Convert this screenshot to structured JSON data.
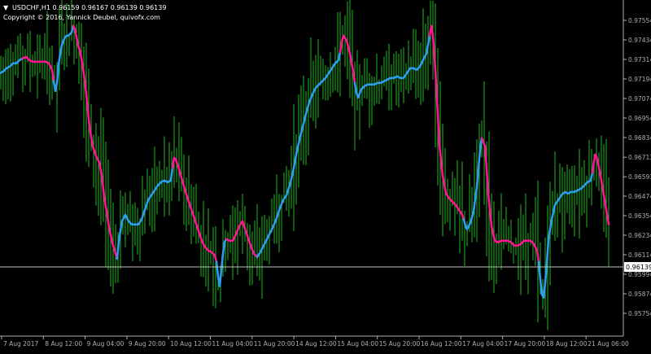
{
  "header": {
    "arrow": "▼",
    "symbol_line": "USDCHF,H1  0.96159 0.96167 0.96139 0.96139",
    "copyright": "Copyright © 2016, Yannick Deubel, quivofx.com"
  },
  "colors": {
    "background": "#000000",
    "bars": "#1fb81f",
    "ma_up": "#2e9cf0",
    "ma_down": "#ff1493",
    "axis": "#b0b0b0",
    "price_line": "#c0c0c0",
    "current_price_box": "#ffffff"
  },
  "current_price": "0.96139",
  "chart_data": {
    "type": "line",
    "title": "USDCHF,H1",
    "y_axis_ticks": [
      0.97554,
      0.97434,
      0.97314,
      0.97194,
      0.97074,
      0.96954,
      0.96834,
      0.96713,
      0.96593,
      0.96474,
      0.96354,
      0.96234,
      0.96114,
      0.95994,
      0.95874,
      0.95754
    ],
    "x_axis_ticks": [
      "7 Aug 2017",
      "8 Aug 12:00",
      "9 Aug 04:00",
      "9 Aug 20:00",
      "10 Aug 12:00",
      "11 Aug 04:00",
      "11 Aug 20:00",
      "14 Aug 12:00",
      "15 Aug 04:00",
      "15 Aug 20:00",
      "16 Aug 12:00",
      "17 Aug 04:00",
      "17 Aug 20:00",
      "18 Aug 12:00",
      "21 Aug 06:00"
    ],
    "ylim": [
      0.95734,
      0.97614
    ],
    "series": [
      {
        "style": "two-color moving average",
        "points": [
          [
            0,
            0.9723,
            "up"
          ],
          [
            4,
            0.9724,
            "up"
          ],
          [
            8,
            0.9726,
            "up"
          ],
          [
            12,
            0.9727,
            "up"
          ],
          [
            16,
            0.9729,
            "up"
          ],
          [
            20,
            0.9729,
            "up"
          ],
          [
            24,
            0.9731,
            "up"
          ],
          [
            28,
            0.9732,
            "down"
          ],
          [
            32,
            0.9733,
            "down"
          ],
          [
            36,
            0.9731,
            "down"
          ],
          [
            40,
            0.973,
            "down"
          ],
          [
            44,
            0.973,
            "down"
          ],
          [
            48,
            0.973,
            "down"
          ],
          [
            52,
            0.973,
            "down"
          ],
          [
            56,
            0.973,
            "down"
          ],
          [
            60,
            0.9729,
            "down"
          ],
          [
            64,
            0.9725,
            "down"
          ],
          [
            66,
            0.9718,
            "up"
          ],
          [
            68,
            0.9712,
            "up"
          ],
          [
            70,
            0.9717,
            "up"
          ],
          [
            72,
            0.9728,
            "up"
          ],
          [
            74,
            0.9735,
            "up"
          ],
          [
            76,
            0.974,
            "up"
          ],
          [
            78,
            0.9743,
            "up"
          ],
          [
            80,
            0.9745,
            "up"
          ],
          [
            82,
            0.9746,
            "up"
          ],
          [
            84,
            0.9746,
            "up"
          ],
          [
            86,
            0.9747,
            "up"
          ],
          [
            88,
            0.9748,
            "up"
          ],
          [
            90,
            0.9752,
            "down"
          ],
          [
            92,
            0.975,
            "down"
          ],
          [
            94,
            0.9745,
            "down"
          ],
          [
            96,
            0.974,
            "down"
          ],
          [
            98,
            0.9737,
            "down"
          ],
          [
            100,
            0.9732,
            "down"
          ],
          [
            102,
            0.9726,
            "down"
          ],
          [
            104,
            0.9719,
            "down"
          ],
          [
            106,
            0.971,
            "down"
          ],
          [
            108,
            0.97,
            "down"
          ],
          [
            110,
            0.969,
            "down"
          ],
          [
            114,
            0.9678,
            "down"
          ],
          [
            118,
            0.9672,
            "down"
          ],
          [
            122,
            0.9668,
            "down"
          ],
          [
            125,
            0.966,
            "down"
          ],
          [
            128,
            0.9647,
            "down"
          ],
          [
            132,
            0.9635,
            "down"
          ],
          [
            134,
            0.9628,
            "down"
          ],
          [
            138,
            0.9619,
            "down"
          ],
          [
            142,
            0.9612,
            "down"
          ],
          [
            144,
            0.9609,
            "up"
          ],
          [
            146,
            0.962,
            "up"
          ],
          [
            150,
            0.9632,
            "up"
          ],
          [
            154,
            0.9636,
            "up"
          ],
          [
            158,
            0.9632,
            "up"
          ],
          [
            162,
            0.963,
            "up"
          ],
          [
            166,
            0.963,
            "up"
          ],
          [
            170,
            0.963,
            "up"
          ],
          [
            174,
            0.9633,
            "up"
          ],
          [
            178,
            0.9639,
            "up"
          ],
          [
            182,
            0.9645,
            "up"
          ],
          [
            186,
            0.9648,
            "up"
          ],
          [
            190,
            0.9651,
            "up"
          ],
          [
            194,
            0.9654,
            "up"
          ],
          [
            198,
            0.9656,
            "up"
          ],
          [
            202,
            0.9657,
            "up"
          ],
          [
            206,
            0.9656,
            "up"
          ],
          [
            210,
            0.9657,
            "up"
          ],
          [
            212,
            0.9665,
            "down"
          ],
          [
            214,
            0.9671,
            "down"
          ],
          [
            216,
            0.967,
            "down"
          ],
          [
            220,
            0.9664,
            "down"
          ],
          [
            224,
            0.9657,
            "down"
          ],
          [
            228,
            0.965,
            "down"
          ],
          [
            232,
            0.9644,
            "down"
          ],
          [
            236,
            0.9638,
            "down"
          ],
          [
            240,
            0.9632,
            "down"
          ],
          [
            244,
            0.9626,
            "down"
          ],
          [
            248,
            0.962,
            "down"
          ],
          [
            252,
            0.9616,
            "down"
          ],
          [
            256,
            0.9614,
            "down"
          ],
          [
            260,
            0.9613,
            "down"
          ],
          [
            264,
            0.9611,
            "down"
          ],
          [
            266,
            0.9607,
            "up"
          ],
          [
            268,
            0.9598,
            "up"
          ],
          [
            270,
            0.9592,
            "up"
          ],
          [
            272,
            0.9602,
            "up"
          ],
          [
            274,
            0.9612,
            "up"
          ],
          [
            276,
            0.9619,
            "up"
          ],
          [
            278,
            0.9621,
            "down"
          ],
          [
            282,
            0.962,
            "down"
          ],
          [
            286,
            0.962,
            "down"
          ],
          [
            290,
            0.9624,
            "down"
          ],
          [
            294,
            0.9629,
            "down"
          ],
          [
            298,
            0.9632,
            "down"
          ],
          [
            300,
            0.9629,
            "down"
          ],
          [
            304,
            0.9623,
            "down"
          ],
          [
            308,
            0.9617,
            "down"
          ],
          [
            312,
            0.9612,
            "down"
          ],
          [
            316,
            0.961,
            "up"
          ],
          [
            320,
            0.9613,
            "up"
          ],
          [
            324,
            0.9617,
            "up"
          ],
          [
            328,
            0.9621,
            "up"
          ],
          [
            332,
            0.9625,
            "up"
          ],
          [
            336,
            0.9629,
            "up"
          ],
          [
            340,
            0.9634,
            "up"
          ],
          [
            344,
            0.964,
            "up"
          ],
          [
            348,
            0.9645,
            "up"
          ],
          [
            352,
            0.9648,
            "up"
          ],
          [
            356,
            0.9654,
            "up"
          ],
          [
            360,
            0.9662,
            "up"
          ],
          [
            364,
            0.9673,
            "up"
          ],
          [
            368,
            0.9682,
            "up"
          ],
          [
            372,
            0.969,
            "up"
          ],
          [
            376,
            0.9698,
            "up"
          ],
          [
            380,
            0.9705,
            "up"
          ],
          [
            384,
            0.971,
            "up"
          ],
          [
            388,
            0.9714,
            "up"
          ],
          [
            392,
            0.9716,
            "up"
          ],
          [
            396,
            0.9718,
            "up"
          ],
          [
            400,
            0.972,
            "up"
          ],
          [
            404,
            0.9723,
            "up"
          ],
          [
            408,
            0.9726,
            "up"
          ],
          [
            412,
            0.9729,
            "up"
          ],
          [
            416,
            0.9731,
            "up"
          ],
          [
            418,
            0.9736,
            "down"
          ],
          [
            420,
            0.9742,
            "down"
          ],
          [
            422,
            0.9746,
            "down"
          ],
          [
            426,
            0.9743,
            "down"
          ],
          [
            430,
            0.9735,
            "down"
          ],
          [
            434,
            0.9724,
            "down"
          ],
          [
            436,
            0.9717,
            "up"
          ],
          [
            438,
            0.9711,
            "up"
          ],
          [
            440,
            0.9708,
            "up"
          ],
          [
            444,
            0.9713,
            "up"
          ],
          [
            448,
            0.9715,
            "up"
          ],
          [
            452,
            0.9716,
            "up"
          ],
          [
            456,
            0.9716,
            "up"
          ],
          [
            460,
            0.9716,
            "up"
          ],
          [
            464,
            0.9717,
            "up"
          ],
          [
            468,
            0.9717,
            "up"
          ],
          [
            472,
            0.9718,
            "up"
          ],
          [
            476,
            0.9719,
            "up"
          ],
          [
            480,
            0.972,
            "up"
          ],
          [
            484,
            0.972,
            "up"
          ],
          [
            488,
            0.9721,
            "up"
          ],
          [
            492,
            0.972,
            "up"
          ],
          [
            496,
            0.972,
            "up"
          ],
          [
            500,
            0.9723,
            "up"
          ],
          [
            504,
            0.9726,
            "up"
          ],
          [
            508,
            0.9726,
            "up"
          ],
          [
            512,
            0.9725,
            "up"
          ],
          [
            516,
            0.9727,
            "up"
          ],
          [
            520,
            0.9731,
            "up"
          ],
          [
            524,
            0.9735,
            "up"
          ],
          [
            528,
            0.9746,
            "down"
          ],
          [
            530,
            0.9752,
            "down"
          ],
          [
            532,
            0.9746,
            "down"
          ],
          [
            534,
            0.9733,
            "down"
          ],
          [
            536,
            0.9716,
            "down"
          ],
          [
            538,
            0.9698,
            "down"
          ],
          [
            540,
            0.9679,
            "down"
          ],
          [
            544,
            0.966,
            "down"
          ],
          [
            548,
            0.9649,
            "down"
          ],
          [
            552,
            0.9646,
            "down"
          ],
          [
            556,
            0.9644,
            "down"
          ],
          [
            560,
            0.9642,
            "down"
          ],
          [
            564,
            0.9639,
            "down"
          ],
          [
            568,
            0.9636,
            "down"
          ],
          [
            570,
            0.9633,
            "up"
          ],
          [
            572,
            0.9629,
            "up"
          ],
          [
            574,
            0.9627,
            "up"
          ],
          [
            578,
            0.9631,
            "up"
          ],
          [
            582,
            0.9638,
            "up"
          ],
          [
            586,
            0.9653,
            "up"
          ],
          [
            590,
            0.9676,
            "up"
          ],
          [
            592,
            0.9683,
            "down"
          ],
          [
            596,
            0.9678,
            "down"
          ],
          [
            598,
            0.9664,
            "down"
          ],
          [
            600,
            0.9649,
            "down"
          ],
          [
            604,
            0.9629,
            "down"
          ],
          [
            608,
            0.962,
            "down"
          ],
          [
            612,
            0.9619,
            "down"
          ],
          [
            616,
            0.962,
            "down"
          ],
          [
            620,
            0.962,
            "down"
          ],
          [
            624,
            0.962,
            "down"
          ],
          [
            628,
            0.9619,
            "down"
          ],
          [
            632,
            0.9617,
            "down"
          ],
          [
            636,
            0.9617,
            "down"
          ],
          [
            640,
            0.9618,
            "down"
          ],
          [
            644,
            0.962,
            "down"
          ],
          [
            648,
            0.962,
            "down"
          ],
          [
            652,
            0.962,
            "down"
          ],
          [
            656,
            0.9618,
            "down"
          ],
          [
            660,
            0.9614,
            "down"
          ],
          [
            662,
            0.9607,
            "up"
          ],
          [
            664,
            0.9596,
            "up"
          ],
          [
            666,
            0.9587,
            "up"
          ],
          [
            668,
            0.9585,
            "up"
          ],
          [
            670,
            0.9594,
            "up"
          ],
          [
            672,
            0.9606,
            "up"
          ],
          [
            674,
            0.9621,
            "up"
          ],
          [
            678,
            0.9633,
            "up"
          ],
          [
            682,
            0.9642,
            "up"
          ],
          [
            686,
            0.9645,
            "up"
          ],
          [
            690,
            0.9648,
            "up"
          ],
          [
            694,
            0.965,
            "up"
          ],
          [
            698,
            0.9649,
            "up"
          ],
          [
            702,
            0.965,
            "up"
          ],
          [
            706,
            0.965,
            "up"
          ],
          [
            710,
            0.9651,
            "up"
          ],
          [
            714,
            0.9652,
            "up"
          ],
          [
            718,
            0.9654,
            "up"
          ],
          [
            722,
            0.9656,
            "up"
          ],
          [
            726,
            0.9657,
            "up"
          ],
          [
            728,
            0.9662,
            "down"
          ],
          [
            730,
            0.9669,
            "down"
          ],
          [
            732,
            0.9673,
            "down"
          ],
          [
            734,
            0.967,
            "down"
          ],
          [
            738,
            0.966,
            "down"
          ],
          [
            742,
            0.9648,
            "down"
          ],
          [
            746,
            0.9636,
            "down"
          ],
          [
            748,
            0.963,
            "down"
          ]
        ]
      }
    ]
  }
}
